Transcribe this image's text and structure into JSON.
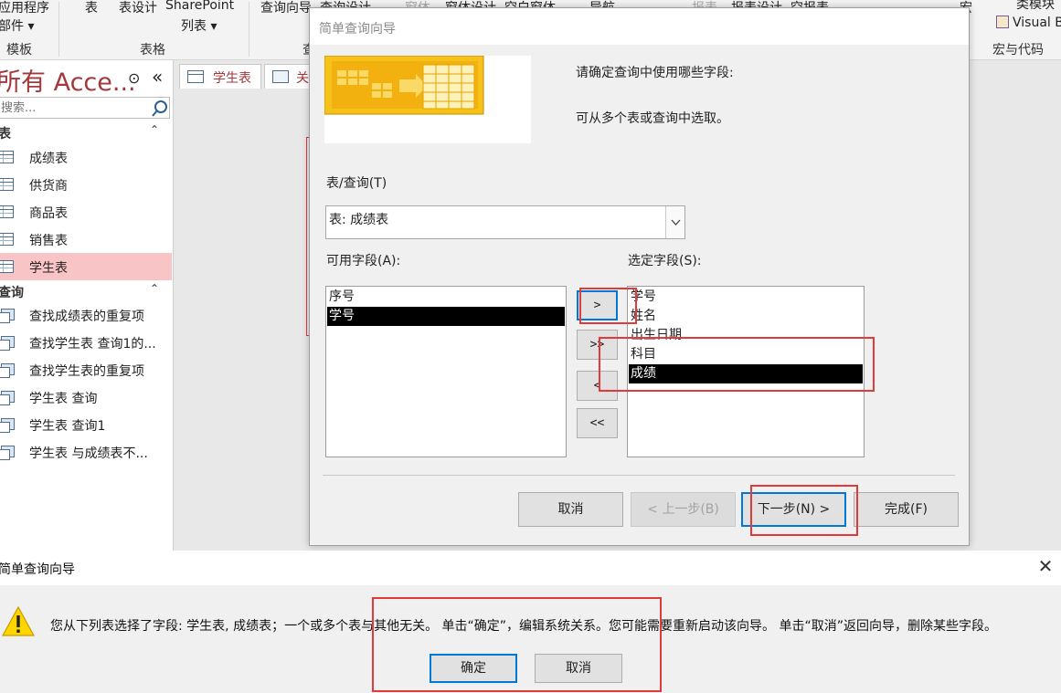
{
  "ribbon": {
    "app_parts_1": "应用程序",
    "app_parts_2": "部件",
    "app_parts_arrow": "▾",
    "table": "表",
    "table_design": "表设计",
    "sharepoint": "SharePoint",
    "list": "列表",
    "list_arrow": "▾",
    "query_wizard": "查询向导",
    "query_design": "查询设计",
    "form": "窗体",
    "form_design": "窗体设计",
    "blank_form": "空白窗体",
    "nav": "导航",
    "report": "报表",
    "report_design": "报表设计",
    "blank_report": "空报表",
    "macro_short": "宏",
    "class_module": "类模块",
    "visual_basic": "Visual B",
    "group_templates": "模板",
    "group_tables": "表格",
    "group_queries": "查",
    "group_macros": "宏与代码"
  },
  "nav": {
    "title": "所有 Acce...",
    "collapse_icon": "«",
    "dropdown_icon": "⊙",
    "search_placeholder": "搜索...",
    "tables_header": "表",
    "queries_header": "查询",
    "section_chevron": "⌃",
    "tables": [
      "成绩表",
      "供货商",
      "商品表",
      "销售表",
      "学生表"
    ],
    "queries": [
      "查找成绩表的重复项",
      "查找学生表 查询1的...",
      "查找学生表的重复项",
      "学生表 查询",
      "学生表 查询1",
      "学生表 与成绩表不..."
    ]
  },
  "doc_tabs": {
    "tab1": "学生表",
    "tab2": "关"
  },
  "wizard": {
    "title": "简单查询向导",
    "prompt1": "请确定查询中使用哪些字段:",
    "prompt2": "可从多个表或查询中选取。",
    "table_query_label": "表/查询(T)",
    "table_query_value": "表: 成绩表",
    "available_label": "可用字段(A):",
    "selected_label": "选定字段(S):",
    "available_fields": [
      "序号",
      "学号"
    ],
    "selected_fields": [
      "学号",
      "姓名",
      "出生日期",
      "科目",
      "成绩"
    ],
    "btn_add": ">",
    "btn_add_all": ">>",
    "btn_remove": "<",
    "btn_remove_all": "<<",
    "btn_cancel": "取消",
    "btn_back": "< 上一步(B)",
    "btn_next": "下一步(N) >",
    "btn_finish": "完成(F)"
  },
  "message": {
    "title": "简单查询向导",
    "text": "您从下列表选择了字段: 学生表, 成绩表；一个或多个表与其他无关。 单击“确定”，编辑系统关系。您可能需要重新启动该向导。 单击“取消”返回向导，删除某些字段。",
    "ok": "确定",
    "cancel": "取消",
    "close_icon": "✕"
  },
  "colors": {
    "accent": "#0078d7",
    "annotation": "#e03a3a",
    "nav_selected": "#f9c4c6",
    "nav_title": "#a4373a"
  }
}
